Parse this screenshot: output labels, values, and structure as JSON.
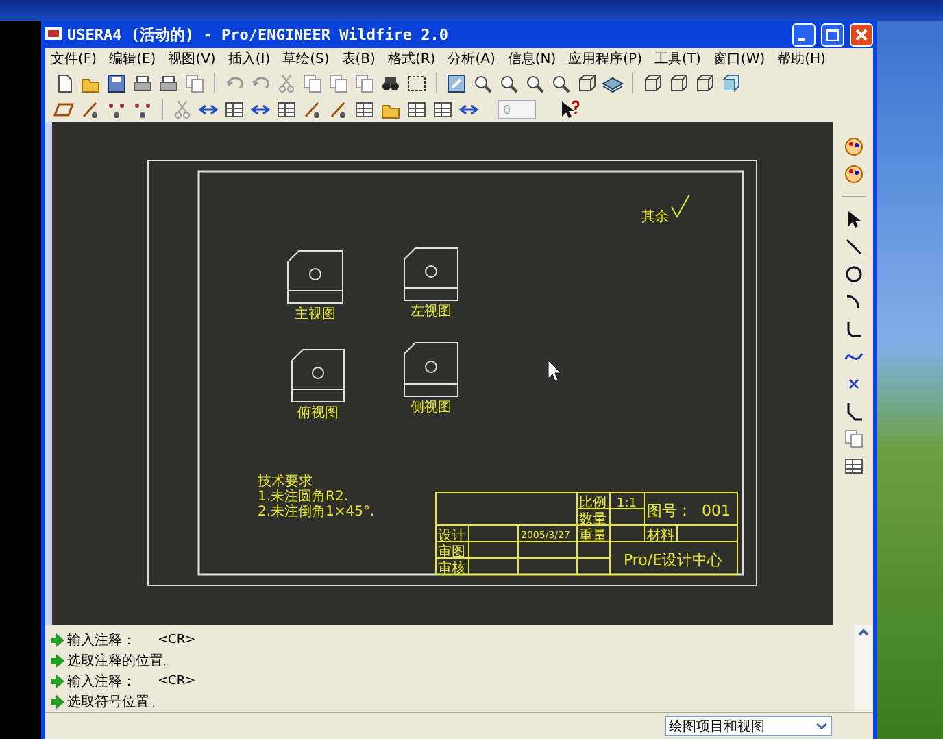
{
  "window": {
    "title": "USERA4 (活动的) - Pro/ENGINEER Wildfire 2.0"
  },
  "menu": [
    {
      "label": "文件(F)"
    },
    {
      "label": "编辑(E)"
    },
    {
      "label": "视图(V)"
    },
    {
      "label": "插入(I)"
    },
    {
      "label": "草绘(S)"
    },
    {
      "label": "表(B)"
    },
    {
      "label": "格式(R)"
    },
    {
      "label": "分析(A)"
    },
    {
      "label": "信息(N)"
    },
    {
      "label": "应用程序(P)"
    },
    {
      "label": "工具(T)"
    },
    {
      "label": "窗口(W)"
    },
    {
      "label": "帮助(H)"
    }
  ],
  "toolbar": {
    "spin_field": {
      "value": "0"
    }
  },
  "drawing": {
    "views": [
      {
        "label": "主视图"
      },
      {
        "label": "左视图"
      },
      {
        "label": "俯视图"
      },
      {
        "label": "侧视图"
      }
    ],
    "surface_note": "其余",
    "notes": [
      "技术要求",
      "1.未注圆角R2.",
      "2.未注倒角1×45°."
    ],
    "title_block": {
      "scale_label": "比例",
      "scale": "1:1",
      "quantity_label": "数量",
      "drawing_no_label": "图号：",
      "drawing_no": "001",
      "designer_label": "设计",
      "date": "2005/3/27",
      "weight_label": "重量",
      "material_label": "材料",
      "checker_label": "审图",
      "reviewer_label": "审核",
      "company": "Pro/E设计中心"
    }
  },
  "messages": [
    {
      "text": "输入注释：",
      "hint": "<CR>"
    },
    {
      "text": "选取注释的位置。"
    },
    {
      "text": "输入注释：",
      "hint": "<CR>"
    },
    {
      "text": "选取符号位置。"
    }
  ],
  "status_bar": {
    "filter": "绘图项目和视图"
  }
}
